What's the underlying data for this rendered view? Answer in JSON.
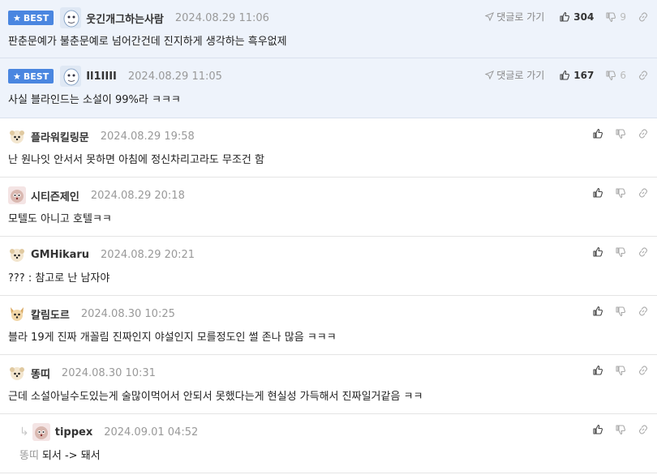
{
  "best_label": "BEST",
  "goto_label": "댓글로 가기",
  "comments": [
    {
      "nick": "웃긴개그하는사람",
      "date": "2024.08.29 11:06",
      "text": "판춘문예가 불춘문예로 넘어간건데 진지하게 생각하는 흑우없제",
      "up": "304",
      "down": "9"
    },
    {
      "nick": "Il1IIII",
      "date": "2024.08.29 11:05",
      "text": "사실 블라인드는 소설이 99%라 ㅋㅋㅋ",
      "up": "167",
      "down": "6"
    },
    {
      "nick": "플라워킬링문",
      "date": "2024.08.29 19:58",
      "text": "난 원나잇 안서서 못하면 아침에 정신차리고라도 무조건 함"
    },
    {
      "nick": "시티즌제인",
      "date": "2024.08.29 20:18",
      "text": "모텔도 아니고 호텔ㅋㅋ"
    },
    {
      "nick": "GMHikaru",
      "date": "2024.08.29 20:21",
      "text": "??? : 참고로 난 남자야"
    },
    {
      "nick": "칼림도르",
      "date": "2024.08.30 10:25",
      "text": "블라 19게 진짜 개꼴림 진짜인지 야설인지 모를정도인 썰 존나 많음 ㅋㅋㅋ"
    },
    {
      "nick": "똥띠",
      "date": "2024.08.30 10:31",
      "text": "근데 소설아닐수도있는게 술많이먹어서 안되서 못했다는게 현실성 가득해서 진짜일거같음 ㅋㅋ"
    },
    {
      "nick": "tippex",
      "date": "2024.09.01 04:52",
      "mention": "똥띠",
      "text": "되서 -> 돼서"
    }
  ],
  "icons": {
    "up": "thumbs-up-icon",
    "down": "thumbs-down-icon",
    "share": "link-icon",
    "goto": "send-arrow-icon"
  },
  "colors": {
    "best_badge": "#4a86e0",
    "best_bg": "#eef3fb"
  }
}
